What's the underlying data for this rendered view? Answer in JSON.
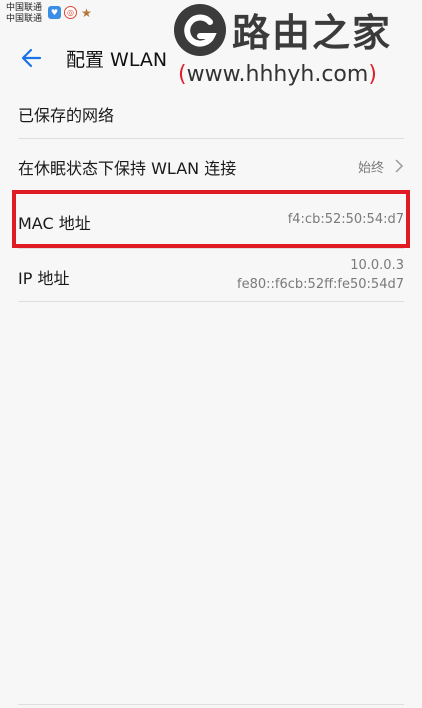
{
  "status_bar": {
    "carrier_1": "中国联通",
    "carrier_2": "中国联通",
    "icons": [
      "message-icon",
      "weibo-icon",
      "star-icon"
    ]
  },
  "header": {
    "title": "配置 WLAN",
    "back_icon": "back-arrow-icon"
  },
  "watermark": {
    "name": "路由之家",
    "url_open": "(",
    "url": "www.hhhyh.com",
    "url_close": ")"
  },
  "settings": [
    {
      "label": "已保存的网络"
    },
    {
      "label": "在休眠状态下保持 WLAN 连接",
      "value": "始终"
    },
    {
      "label": "MAC 地址",
      "value": "f4:cb:52:50:54:d7"
    },
    {
      "label": "IP 地址",
      "value_line1": "10.0.0.3",
      "value_line2": "fe80::f6cb:52ff:fe50:54d7"
    }
  ],
  "colors": {
    "accent": "#1a73e8",
    "highlight": "#e01b24",
    "background": "#f7f7f7"
  }
}
